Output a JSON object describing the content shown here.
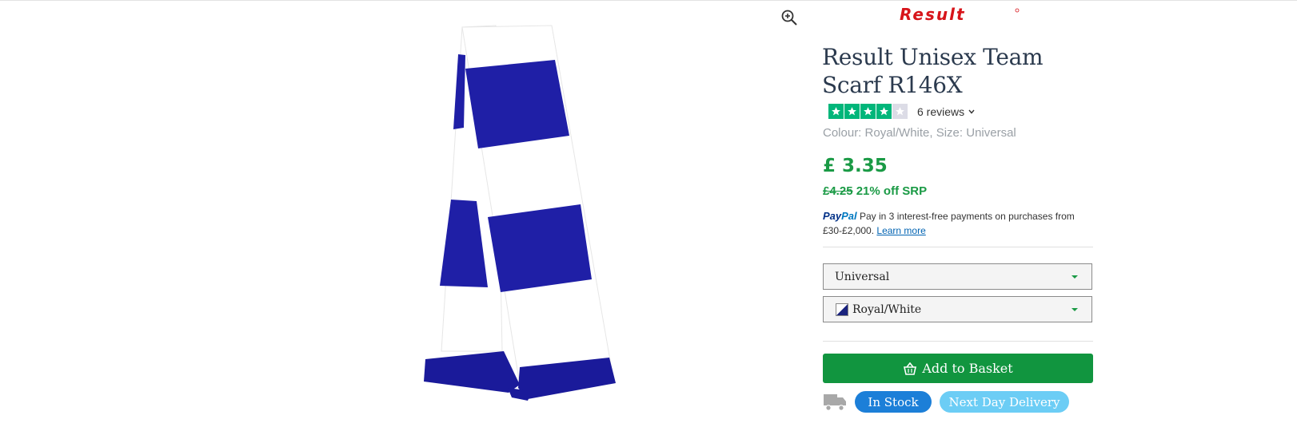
{
  "brand": {
    "logo_text": "Result",
    "logo_color": "#d7141a"
  },
  "product": {
    "title": "Result Unisex Team Scarf R146X",
    "rating": {
      "stars": 4,
      "max": 5,
      "reviews_label": "6 reviews"
    },
    "variant_info": "Colour: Royal/White, Size: Universal",
    "price": "£ 3.35",
    "srp_old": "£4.25",
    "srp_discount": "21% off SRP",
    "image_colors": {
      "stripe": "#1a1aa0",
      "base": "#ffffff"
    }
  },
  "paypal": {
    "logo_pay": "Pay",
    "logo_pal": "Pal",
    "text": "Pay in 3 interest-free payments on purchases from £30-£2,000.",
    "link": "Learn more"
  },
  "selects": {
    "size": {
      "value": "Universal"
    },
    "colour": {
      "value": "Royal/White"
    }
  },
  "actions": {
    "add_to_basket": "Add to Basket"
  },
  "badges": {
    "in_stock": "In Stock",
    "next_day": "Next Day Delivery"
  },
  "colors": {
    "accent_green": "#11953f",
    "price_green": "#1a9a45",
    "stock_blue": "#1c7fd8",
    "delivery_blue": "#6ccdf5",
    "star_green": "#00b67a"
  },
  "icons": [
    "zoom-in-icon",
    "star-icon",
    "chevron-down-icon",
    "paypal-icon",
    "basket-icon",
    "truck-icon",
    "caret-down-icon"
  ]
}
